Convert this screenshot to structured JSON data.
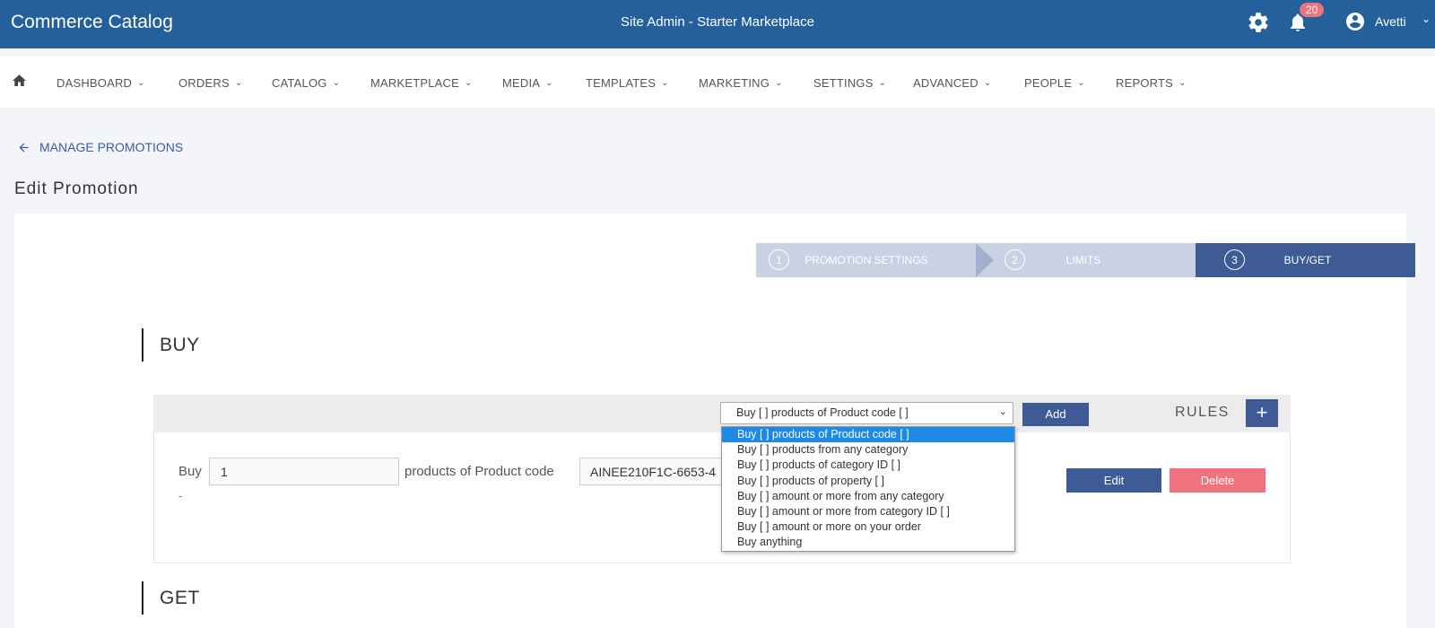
{
  "topbar": {
    "app_title": "Commerce Catalog",
    "site_title": "Site Admin - Starter Marketplace",
    "notification_count": "20",
    "user_name": "Avetti"
  },
  "menu": {
    "items": [
      {
        "label": "DASHBOARD"
      },
      {
        "label": "ORDERS"
      },
      {
        "label": "CATALOG"
      },
      {
        "label": "MARKETPLACE"
      },
      {
        "label": "MEDIA"
      },
      {
        "label": "TEMPLATES"
      },
      {
        "label": "MARKETING"
      },
      {
        "label": "SETTINGS"
      },
      {
        "label": "ADVANCED"
      },
      {
        "label": "PEOPLE"
      },
      {
        "label": "REPORTS"
      }
    ]
  },
  "back_link": "MANAGE PROMOTIONS",
  "page_title": "Edit Promotion",
  "stepper": {
    "steps": [
      {
        "number": "1",
        "label": "PROMOTION SETTINGS"
      },
      {
        "number": "2",
        "label": "LIMITS"
      },
      {
        "number": "3",
        "label": "BUY/GET"
      }
    ],
    "active_step": 3
  },
  "buy_section": {
    "heading": "BUY",
    "rule_type_selected": "Buy [ ] products of Product code [ ]",
    "add_label": "Add",
    "rules_label": "RULES",
    "plus_label": "+",
    "rule": {
      "prefix": "Buy",
      "quantity": "1",
      "middle_text": "products of Product code",
      "product_code": "AINEE210F1C-6653-4",
      "dash": "-",
      "edit_label": "Edit",
      "delete_label": "Delete"
    },
    "dropdown_options": [
      "Buy [ ] products of Product code [ ]",
      "Buy [ ] products from any category",
      "Buy [ ] products of category ID [ ]",
      "Buy [ ] products of property [ ]",
      "Buy [ ] amount or more from any category",
      "Buy [ ] amount or more from category ID [ ]",
      "Buy [ ] amount or more on your order",
      "Buy anything"
    ]
  },
  "get_section": {
    "heading": "GET"
  },
  "colors": {
    "topbar": "#23609c",
    "primary_button": "#3f5b96",
    "delete_button": "#f0727f",
    "step_inactive": "#c9d1e3",
    "link": "#3a5ba8",
    "option_highlight": "#1e88e5"
  }
}
